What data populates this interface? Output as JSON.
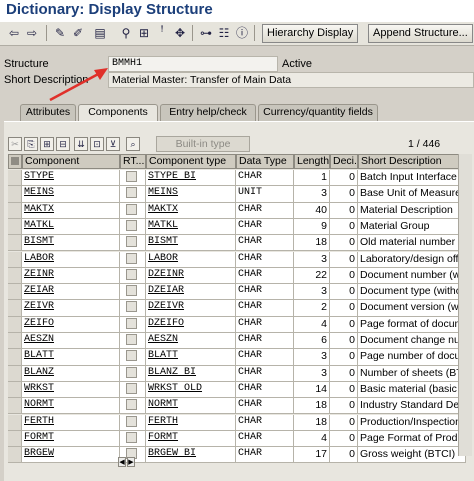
{
  "window": {
    "title": "Dictionary: Display Structure"
  },
  "toolbar": {
    "hierarchy_display": "Hierarchy Display",
    "append_structure": "Append Structure...",
    "icons": [
      "back-icon",
      "forward-icon",
      "edit-icon",
      "display-change-icon",
      "object-list-icon",
      "where-used-icon",
      "check-icon",
      "activate-icon",
      "navigate-icon",
      "hierarchy-icon",
      "tree-icon",
      "info-icon"
    ]
  },
  "header": {
    "structure_label": "Structure",
    "structure_value": "BMMH1",
    "status": "Active",
    "short_desc_label": "Short Description",
    "short_desc_value": "Material Master: Transfer of Main Data"
  },
  "tabs": [
    {
      "label": "Attributes",
      "active": false
    },
    {
      "label": "Components",
      "active": true
    },
    {
      "label": "Entry help/check",
      "active": false
    },
    {
      "label": "Currency/quantity fields",
      "active": false
    }
  ],
  "table_toolbar": {
    "builtin_type": "Built-in type",
    "position": "1",
    "separator": "/",
    "total": "446"
  },
  "columns": [
    "Component",
    "RT...",
    "Component type",
    "Data Type",
    "Length",
    "Deci...",
    "Short Description"
  ],
  "rows": [
    {
      "component": "STYPE",
      "comp_type": "STYPE BI",
      "data_type": "CHAR",
      "length": "1",
      "decimals": "0",
      "desc": "Batch Input Interface Record"
    },
    {
      "component": "MEINS",
      "comp_type": "MEINS",
      "data_type": "UNIT",
      "length": "3",
      "decimals": "0",
      "desc": "Base Unit of Measure"
    },
    {
      "component": "MAKTX",
      "comp_type": "MAKTX",
      "data_type": "CHAR",
      "length": "40",
      "decimals": "0",
      "desc": "Material Description"
    },
    {
      "component": "MATKL",
      "comp_type": "MATKL",
      "data_type": "CHAR",
      "length": "9",
      "decimals": "0",
      "desc": "Material Group"
    },
    {
      "component": "BISMT",
      "comp_type": "BISMT",
      "data_type": "CHAR",
      "length": "18",
      "decimals": "0",
      "desc": "Old material number"
    },
    {
      "component": "LABOR",
      "comp_type": "LABOR",
      "data_type": "CHAR",
      "length": "3",
      "decimals": "0",
      "desc": "Laboratory/design office"
    },
    {
      "component": "ZEINR",
      "comp_type": "DZEINR",
      "data_type": "CHAR",
      "length": "22",
      "decimals": "0",
      "desc": "Document number (without"
    },
    {
      "component": "ZEIAR",
      "comp_type": "DZEIAR",
      "data_type": "CHAR",
      "length": "3",
      "decimals": "0",
      "desc": "Document type (without Do"
    },
    {
      "component": "ZEIVR",
      "comp_type": "DZEIVR",
      "data_type": "CHAR",
      "length": "2",
      "decimals": "0",
      "desc": "Document version (without"
    },
    {
      "component": "ZEIFO",
      "comp_type": "DZEIFO",
      "data_type": "CHAR",
      "length": "4",
      "decimals": "0",
      "desc": "Page format of document (w"
    },
    {
      "component": "AESZN",
      "comp_type": "AESZN",
      "data_type": "CHAR",
      "length": "6",
      "decimals": "0",
      "desc": "Document change number"
    },
    {
      "component": "BLATT",
      "comp_type": "BLATT",
      "data_type": "CHAR",
      "length": "3",
      "decimals": "0",
      "desc": "Page number of document"
    },
    {
      "component": "BLANZ",
      "comp_type": "BLANZ BI",
      "data_type": "CHAR",
      "length": "3",
      "decimals": "0",
      "desc": "Number of sheets (BTCI)"
    },
    {
      "component": "WRKST",
      "comp_type": "WRKST OLD",
      "data_type": "CHAR",
      "length": "14",
      "decimals": "0",
      "desc": "Basic material (basic cons"
    },
    {
      "component": "NORMT",
      "comp_type": "NORMT",
      "data_type": "CHAR",
      "length": "18",
      "decimals": "0",
      "desc": "Industry Standard Descript"
    },
    {
      "component": "FERTH",
      "comp_type": "FERTH",
      "data_type": "CHAR",
      "length": "18",
      "decimals": "0",
      "desc": "Production/Inspection Mem"
    },
    {
      "component": "FORMT",
      "comp_type": "FORMT",
      "data_type": "CHAR",
      "length": "4",
      "decimals": "0",
      "desc": "Page Format of Production"
    },
    {
      "component": "BRGEW",
      "comp_type": "BRGEW BI",
      "data_type": "CHAR",
      "length": "17",
      "decimals": "0",
      "desc": "Gross weight (BTCI)"
    }
  ],
  "annotation_color": "#e0302a"
}
